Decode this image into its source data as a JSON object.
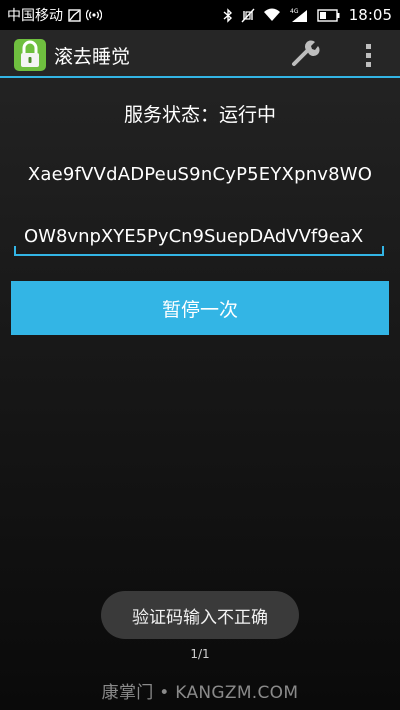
{
  "status_bar": {
    "carrier": "中国移动",
    "network_type": "4G",
    "time": "18:05"
  },
  "action_bar": {
    "title": "滚去睡觉",
    "accent_color": "#33b5e5"
  },
  "main": {
    "status_text": "服务状态：运行中",
    "code_display": "Xae9fVVdADPeuS9nCyP5EYXpnv8WO",
    "code_input_value": "OW8vnpXYE5PyCn9SuepDAdVVf9eaX",
    "pause_button_label": "暂停一次"
  },
  "toast": {
    "message": "验证码输入不正确"
  },
  "page_counter": "1/1",
  "watermark": "康掌门 • KANGZM.COM"
}
